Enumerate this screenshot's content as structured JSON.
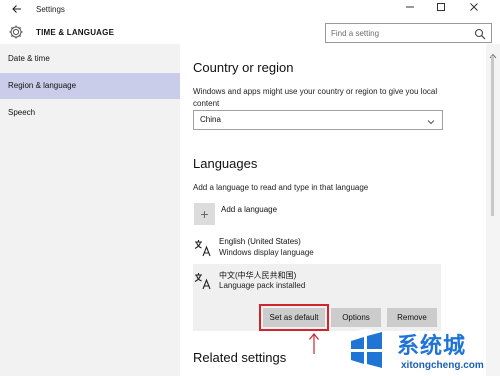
{
  "window": {
    "title": "Settings",
    "back_icon": "back-arrow-icon",
    "controls": [
      "minimize-icon",
      "maximize-icon",
      "close-icon"
    ]
  },
  "header": {
    "icon": "gear-icon",
    "title": "TIME & LANGUAGE",
    "search_placeholder": "Find a setting"
  },
  "sidebar": {
    "items": [
      {
        "label": "Date & time",
        "active": false
      },
      {
        "label": "Region & language",
        "active": true
      },
      {
        "label": "Speech",
        "active": false
      }
    ],
    "active_color": "#c9cde9"
  },
  "main": {
    "region": {
      "heading": "Country or region",
      "description": "Windows and apps might use your country or region to give you local content",
      "selected": "China"
    },
    "languages": {
      "heading": "Languages",
      "description": "Add a language to read and type in that language",
      "add_label": "Add a language",
      "items": [
        {
          "name": "English (United States)",
          "status": "Windows display language"
        },
        {
          "name": "中文(中华人民共和国)",
          "status": "Language pack installed"
        }
      ],
      "buttons": {
        "set_default": "Set as default",
        "options": "Options",
        "remove": "Remove"
      },
      "highlight_color": "#d0252c"
    },
    "related": {
      "heading": "Related settings"
    }
  },
  "watermark": {
    "brand_cn": "系统城",
    "url": "xitongcheng.com",
    "color": "#1f74d6"
  }
}
